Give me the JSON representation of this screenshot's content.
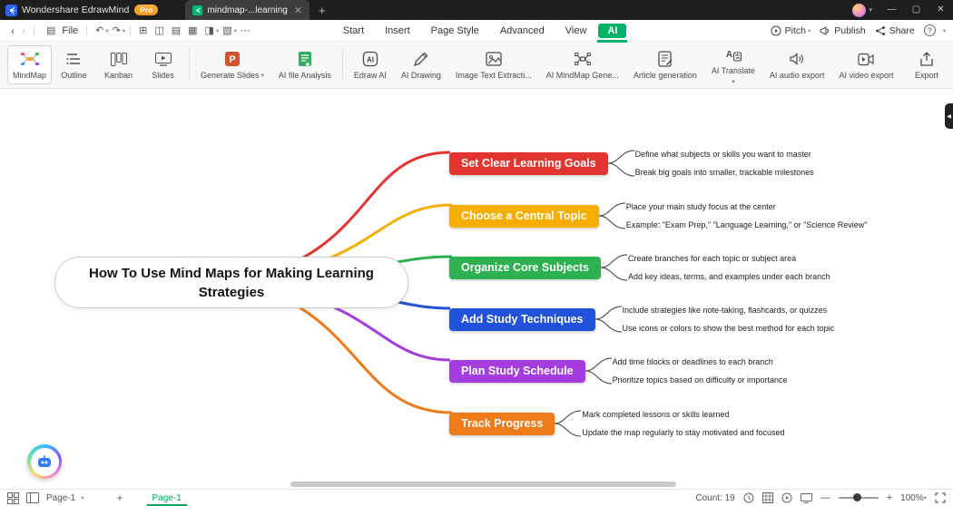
{
  "titlebar": {
    "app_name": "Wondershare EdrawMind",
    "pro_badge": "Pro",
    "tab_title": "mindmap-...learning",
    "tab_close": "✕",
    "new_tab": "+",
    "window_controls": {
      "minimize": "—",
      "maximize": "▢",
      "close": "✕"
    }
  },
  "menubar": {
    "back": "‹",
    "forward": "›",
    "file_label": "File",
    "menus": [
      "Start",
      "Insert",
      "Page Style",
      "Advanced",
      "View",
      "AI"
    ],
    "active_menu": "AI",
    "pitch": "Pitch",
    "publish": "Publish",
    "share": "Share"
  },
  "ribbon": {
    "view_modes": [
      "MindMap",
      "Outline",
      "Kanban",
      "Slides"
    ],
    "active_view_mode": "MindMap",
    "tools": [
      "Generate Slides",
      "AI file Analysis",
      "Edraw AI",
      "AI Drawing",
      "Image Text Extracti...",
      "AI MindMap Gene...",
      "Article generation",
      "AI Translate",
      "AI audio export",
      "AI video export"
    ],
    "export_label": "Export"
  },
  "canvas": {
    "central_topic": "How To Use Mind Maps for Making Learning Strategies",
    "branches": [
      {
        "label": "Set Clear Learning Goals",
        "color": "#e23530",
        "subtopics": [
          "Define what subjects or skills you want to master",
          "Break big goals into smaller, trackable milestones"
        ]
      },
      {
        "label": "Choose a Central Topic",
        "color": "#f5ae00",
        "subtopics": [
          "Place your main study focus at the center",
          "Example: \"Exam Prep,\" \"Language Learning,\" or \"Science Review\""
        ]
      },
      {
        "label": "Organize Core Subjects",
        "color": "#2eb150",
        "subtopics": [
          "Create branches for each topic or subject area",
          "Add key ideas, terms, and examples under each branch"
        ]
      },
      {
        "label": "Add Study Techniques",
        "color": "#2152d9",
        "subtopics": [
          "Include strategies like note-taking, flashcards, or quizzes",
          "Use icons or colors to show the best method for each topic"
        ]
      },
      {
        "label": "Plan Study Schedule",
        "color": "#a43ce0",
        "subtopics": [
          "Add time blocks or deadlines to each branch",
          "Prioritize topics based on difficulty or importance"
        ]
      },
      {
        "label": "Track Progress",
        "color": "#ef7a1a",
        "subtopics": [
          "Mark completed lessons or skills learned",
          "Update the map regularly to stay motivated and focused"
        ]
      }
    ]
  },
  "statusbar": {
    "page_selector": "Page-1",
    "add_page": "+",
    "active_page": "Page-1",
    "count_label": "Count: 19",
    "zoom_value": "100%"
  },
  "colors": {
    "accent_green": "#00b268"
  }
}
